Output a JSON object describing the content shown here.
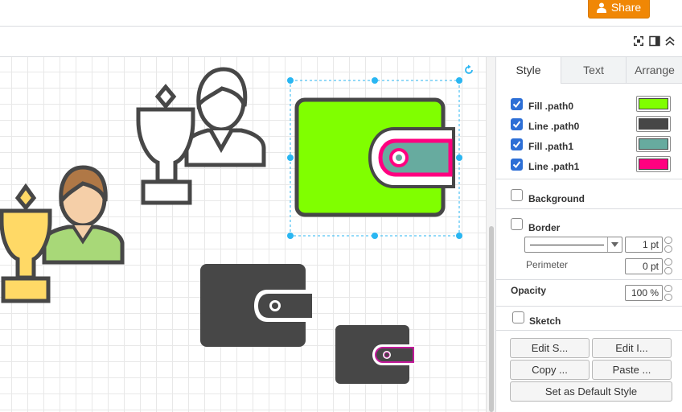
{
  "header": {
    "share_label": "Share"
  },
  "panel": {
    "tabs": [
      {
        "label": "Style"
      },
      {
        "label": "Text"
      },
      {
        "label": "Arrange"
      }
    ],
    "style_rows": [
      {
        "label": "Fill .path0",
        "checked": true,
        "color": "#80ff00"
      },
      {
        "label": "Line .path0",
        "checked": true,
        "color": "#474747"
      },
      {
        "label": "Fill .path1",
        "checked": true,
        "color": "#67ab9f"
      },
      {
        "label": "Line .path1",
        "checked": true,
        "color": "#ff0080"
      }
    ],
    "background_label": "Background",
    "border_label": "Border",
    "border_width": "1 pt",
    "perimeter_label": "Perimeter",
    "perimeter_value": "0 pt",
    "opacity_label": "Opacity",
    "opacity_value": "100 %",
    "sketch_label": "Sketch",
    "buttons": {
      "edit_style": "Edit S...",
      "edit_image": "Edit I...",
      "copy_style": "Copy ...",
      "paste_style": "Paste ...",
      "set_default": "Set as Default Style"
    }
  },
  "colors": {
    "accent": "#f08705",
    "selection": "#29b6f2",
    "icon_dark": "#474747",
    "wallet_green": "#80ff00",
    "wallet_teal": "#67ab9f",
    "wallet_pink": "#ff0080",
    "trophy_yellow": "#ffd966",
    "person_hair": "#b07846",
    "person_skin": "#f5cfa8",
    "person_shirt": "#a8d878"
  }
}
